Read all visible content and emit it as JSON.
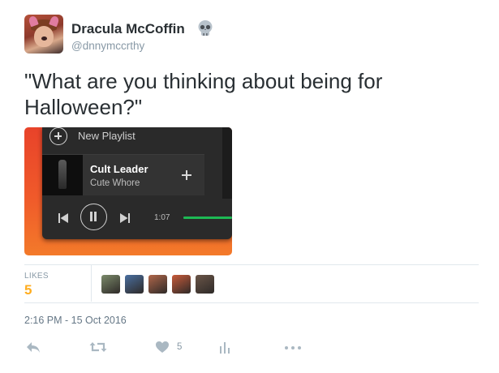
{
  "author": {
    "display_name": "Dracula McCoffin",
    "handle": "@dnnymccrthy",
    "name_emoji_icon": "skull-icon"
  },
  "tweet": {
    "text": "\"What are you thinking about being for Halloween?\""
  },
  "media": {
    "new_playlist_label": "New Playlist",
    "track_name": "Cult Leader",
    "track_artist": "Cute Whore",
    "elapsed_time": "1:07",
    "progress_fraction": 1.0,
    "icons": [
      "plus-circle-icon",
      "add-icon",
      "previous-icon",
      "pause-icon",
      "next-icon"
    ],
    "colors": {
      "background": "#f05a2a",
      "panel": "#2a2a2a",
      "progress": "#1db954"
    }
  },
  "stats": {
    "likes_label": "LIKES",
    "likes_count": "5",
    "liker_avatar_colors": [
      "#7b8a6a",
      "#4a6fa0",
      "#b0664a",
      "#c85a3a",
      "#6a5548"
    ]
  },
  "timestamp": "2:16 PM - 15 Oct 2016",
  "actions": {
    "icons": [
      "reply-icon",
      "retweet-icon",
      "like-icon",
      "analytics-icon",
      "more-icon"
    ],
    "like_count": "5",
    "icon_color": "#aab8c2"
  }
}
